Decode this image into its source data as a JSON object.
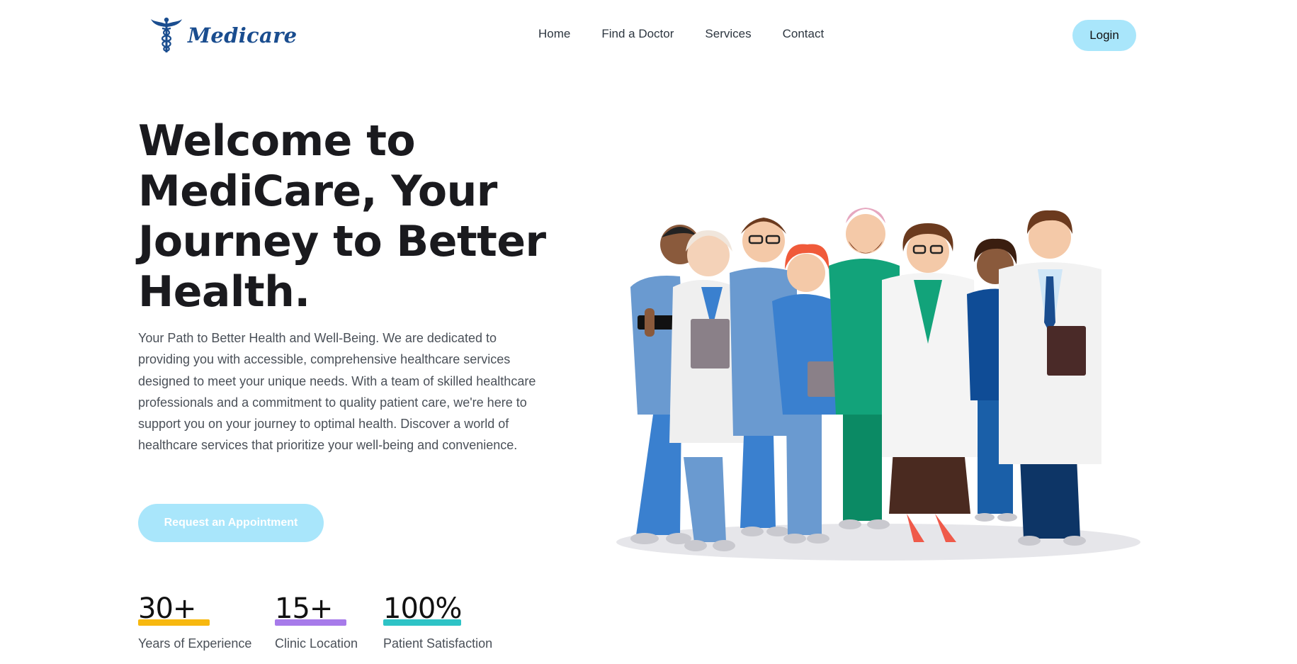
{
  "brand": {
    "name": "Medicare",
    "logo_icon": "caduceus-icon",
    "color": "#1a4d8f"
  },
  "nav": {
    "items": [
      {
        "label": "Home"
      },
      {
        "label": "Find a Doctor"
      },
      {
        "label": "Services"
      },
      {
        "label": "Contact"
      }
    ],
    "login_label": "Login"
  },
  "hero": {
    "title": "Welcome to MediCare, Your Journey to Better Health.",
    "description": "Your Path to Better Health and Well-Being. We are dedicated to providing you with accessible, comprehensive healthcare services designed to meet your unique needs. With a team of skilled healthcare professionals and a commitment to quality patient care, we're here to support you on your journey to optimal health. Discover a world of healthcare services that prioritize your well-being and convenience.",
    "cta_label": "Request an Appointment",
    "illustration": "medical-team-illustration"
  },
  "stats": [
    {
      "value": "30+",
      "label": "Years of Experience",
      "color": "#f7b80f"
    },
    {
      "value": "15+",
      "label": "Clinic Location",
      "color": "#a77bea"
    },
    {
      "value": "100%",
      "label": "Patient Satisfaction",
      "color": "#2ec3c6"
    }
  ],
  "colors": {
    "accent": "#a9e6fb"
  }
}
